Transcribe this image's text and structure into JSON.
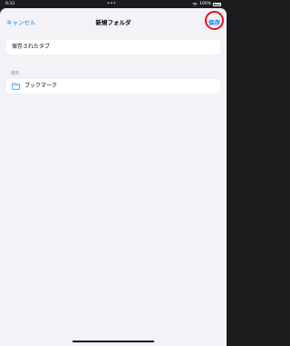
{
  "status_bar": {
    "time": "9:33",
    "dots": "•••",
    "battery_text": "100%"
  },
  "nav": {
    "cancel_label": "キャンセル",
    "title": "新規フォルダ",
    "save_label": "保存"
  },
  "name_field": {
    "value": "保存されたタブ"
  },
  "location": {
    "header": "場所",
    "folder_label": "ブックマーク"
  },
  "colors": {
    "accent": "#0a84ff",
    "highlight": "#e3131b",
    "background": "#f2f2f7"
  }
}
